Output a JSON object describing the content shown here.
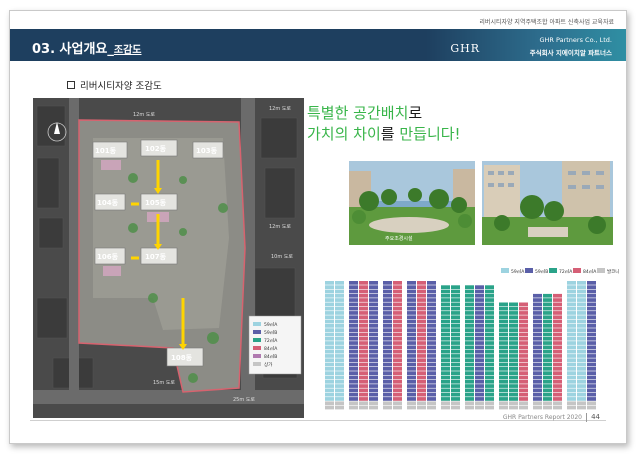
{
  "header": {
    "top_tagline": "리버시티자양 지역주택조합 아파트 신축사업 교육자료",
    "section_title": "03. 사업개요_",
    "section_subtitle": "조감도",
    "logo_text": "GHR",
    "logo_company_en": "GHR Partners Co., Ltd.",
    "logo_company_ko": "주식회사 지에이치알 파트너스"
  },
  "content": {
    "section_label": "리버시티자양 조감도",
    "headline_line1_a": "특별한 공간배치",
    "headline_line1_b": "로",
    "headline_line2_a": "가치의 차이",
    "headline_line2_b": "를 ",
    "headline_line2_c": "만듭니다!",
    "photo_caption": "주요조경시설"
  },
  "site_plan": {
    "buildings": [
      "101동",
      "102동",
      "103동",
      "104동",
      "105동",
      "106동",
      "107동",
      "108동"
    ],
    "road_labels": [
      "12m 도로",
      "12m 도로",
      "12m 도로",
      "10m 도로",
      "15m 도로",
      "25m 도로"
    ],
    "colors": {
      "road": "#5a5a5a",
      "outline": "#d7636f",
      "arrow": "#ffd400",
      "arrow_label": "#e8a000"
    },
    "legend_items": [
      "59㎡A",
      "59㎡B",
      "72㎡A",
      "84㎡A",
      "84㎡B",
      "상가"
    ]
  },
  "unit_legend": [
    "59㎡A",
    "59㎡B",
    "72㎡A",
    "84㎡A",
    "발코니"
  ],
  "unit_colors": {
    "59A": "#9dd3e0",
    "59B": "#5a5fa8",
    "72A": "#2aa389",
    "84A": "#d55f76",
    "balcony": "#c5c5c5"
  },
  "footer": {
    "report": "GHR Partners Report 2020",
    "page": "44"
  }
}
